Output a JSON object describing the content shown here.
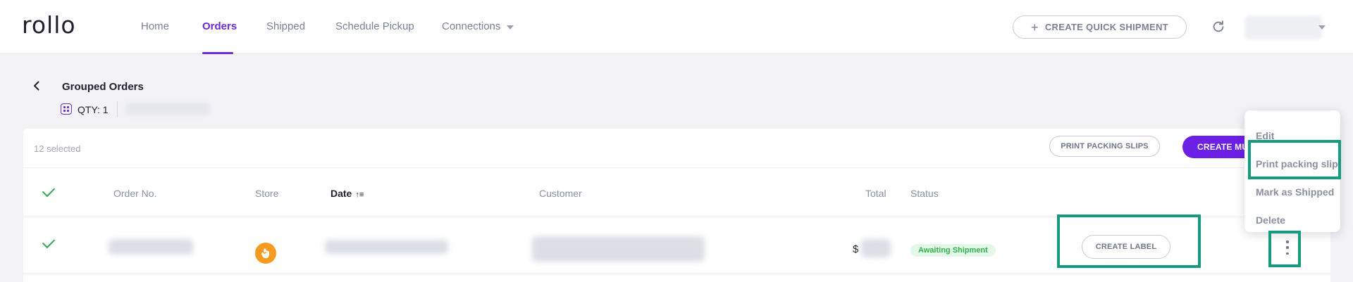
{
  "app": {
    "logo": "rollo"
  },
  "nav": {
    "items": [
      {
        "label": "Home"
      },
      {
        "label": "Orders"
      },
      {
        "label": "Shipped"
      },
      {
        "label": "Schedule Pickup"
      },
      {
        "label": "Connections"
      }
    ],
    "active": "Orders",
    "quick_shipment_label": "CREATE QUICK SHIPMENT"
  },
  "page": {
    "title": "Grouped Orders",
    "qty_label": "QTY: 1"
  },
  "toolbar": {
    "selected_text": "12 selected",
    "print_slips_label": "PRINT PACKING SLIPS",
    "create_multi_label": "CREATE MU"
  },
  "table": {
    "columns": [
      {
        "label": "Order No."
      },
      {
        "label": "Store"
      },
      {
        "label": "Date"
      },
      {
        "label": "Customer"
      },
      {
        "label": "Total"
      },
      {
        "label": "Status"
      }
    ],
    "rows": [
      {
        "total_currency": "$",
        "status": "Awaiting Shipment",
        "action_label": "CREATE LABEL"
      }
    ]
  },
  "menu": {
    "items": [
      {
        "label": "Edit"
      },
      {
        "label": "Print packing slip"
      },
      {
        "label": "Mark as Shipped"
      },
      {
        "label": "Delete"
      }
    ]
  },
  "colors": {
    "accent": "#6c2bd9",
    "highlight": "#169b7f",
    "success": "#34a853",
    "store_icon": "#f79a1e"
  }
}
